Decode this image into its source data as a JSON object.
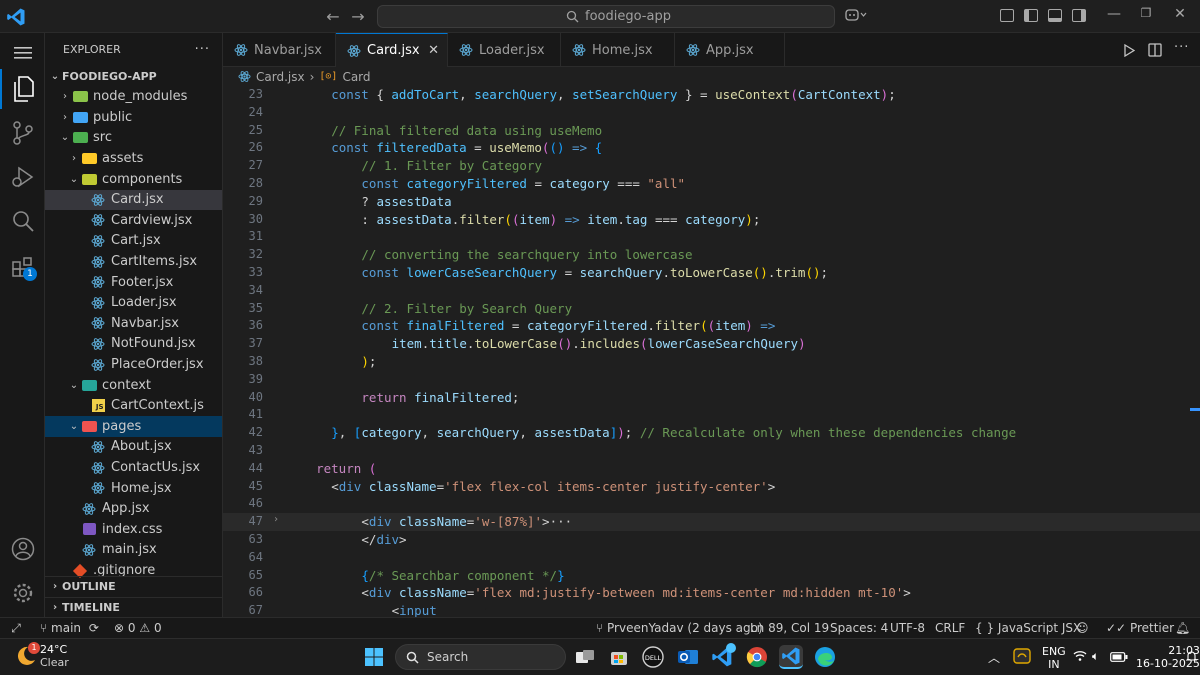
{
  "titlebar": {
    "search_text": "foodiego-app"
  },
  "sidebar": {
    "title": "EXPLORER",
    "more": "···",
    "project": "FOODIEGO-APP",
    "tree": [
      {
        "label": "node_modules",
        "depth": 1,
        "type": "folder",
        "open": false,
        "icon": "folder-node"
      },
      {
        "label": "public",
        "depth": 1,
        "type": "folder",
        "open": false,
        "icon": "folder-public"
      },
      {
        "label": "src",
        "depth": 1,
        "type": "folder",
        "open": true,
        "icon": "folder-src"
      },
      {
        "label": "assets",
        "depth": 2,
        "type": "folder",
        "open": false,
        "icon": "folder-assets"
      },
      {
        "label": "components",
        "depth": 2,
        "type": "folder",
        "open": true,
        "icon": "folder-components"
      },
      {
        "label": "Card.jsx",
        "depth": 3,
        "type": "react",
        "selected": true
      },
      {
        "label": "Cardview.jsx",
        "depth": 3,
        "type": "react"
      },
      {
        "label": "Cart.jsx",
        "depth": 3,
        "type": "react"
      },
      {
        "label": "CartItems.jsx",
        "depth": 3,
        "type": "react"
      },
      {
        "label": "Footer.jsx",
        "depth": 3,
        "type": "react"
      },
      {
        "label": "Loader.jsx",
        "depth": 3,
        "type": "react"
      },
      {
        "label": "Navbar.jsx",
        "depth": 3,
        "type": "react"
      },
      {
        "label": "NotFound.jsx",
        "depth": 3,
        "type": "react"
      },
      {
        "label": "PlaceOrder.jsx",
        "depth": 3,
        "type": "react"
      },
      {
        "label": "context",
        "depth": 2,
        "type": "folder",
        "open": true,
        "icon": "folder-context"
      },
      {
        "label": "CartContext.js",
        "depth": 3,
        "type": "js"
      },
      {
        "label": "pages",
        "depth": 2,
        "type": "folder",
        "open": true,
        "icon": "folder-pages",
        "focused": true
      },
      {
        "label": "About.jsx",
        "depth": 3,
        "type": "react"
      },
      {
        "label": "ContactUs.jsx",
        "depth": 3,
        "type": "react"
      },
      {
        "label": "Home.jsx",
        "depth": 3,
        "type": "react"
      },
      {
        "label": "App.jsx",
        "depth": 2,
        "type": "react"
      },
      {
        "label": "index.css",
        "depth": 2,
        "type": "css"
      },
      {
        "label": "main.jsx",
        "depth": 2,
        "type": "react"
      },
      {
        "label": ".gitignore",
        "depth": 1,
        "type": "git"
      }
    ],
    "outline": "OUTLINE",
    "timeline": "TIMELINE"
  },
  "tabs": [
    {
      "label": "Navbar.jsx",
      "active": false
    },
    {
      "label": "Card.jsx",
      "active": true
    },
    {
      "label": "Loader.jsx",
      "active": false
    },
    {
      "label": "Home.jsx",
      "active": false
    },
    {
      "label": "App.jsx",
      "active": false
    }
  ],
  "breadcrumb": {
    "file": "Card.jsx",
    "symbol": "Card"
  },
  "editor": {
    "lines": [
      {
        "n": "23",
        "indent": 1,
        "t": [
          [
            "dk",
            "const "
          ],
          [
            "pn",
            "{ "
          ],
          [
            "cn",
            "addToCart"
          ],
          [
            "pn",
            ", "
          ],
          [
            "cn",
            "searchQuery"
          ],
          [
            "pn",
            ", "
          ],
          [
            "cn",
            "setSearchQuery"
          ],
          [
            "pn",
            " } = "
          ],
          [
            "fn",
            "useContext"
          ],
          [
            "b2",
            "("
          ],
          [
            "vr",
            "CartContext"
          ],
          [
            "b2",
            ")"
          ],
          [
            "pn",
            ";"
          ]
        ]
      },
      {
        "n": "24",
        "indent": 0,
        "t": []
      },
      {
        "n": "25",
        "indent": 1,
        "t": [
          [
            "cm",
            "// Final filtered data using useMemo"
          ]
        ]
      },
      {
        "n": "26",
        "indent": 1,
        "t": [
          [
            "dk",
            "const "
          ],
          [
            "cn",
            "filteredData"
          ],
          [
            "pn",
            " = "
          ],
          [
            "fn",
            "useMemo"
          ],
          [
            "b2",
            "("
          ],
          [
            "b3",
            "("
          ],
          [
            "b3",
            ")"
          ],
          [
            "dk",
            " =>"
          ],
          [
            "pn",
            " "
          ],
          [
            "b3",
            "{"
          ]
        ]
      },
      {
        "n": "27",
        "indent": 2,
        "t": [
          [
            "cm",
            "// 1. Filter by Category"
          ]
        ]
      },
      {
        "n": "28",
        "indent": 2,
        "t": [
          [
            "dk",
            "const "
          ],
          [
            "cn",
            "categoryFiltered"
          ],
          [
            "pn",
            " = "
          ],
          [
            "vr",
            "category"
          ],
          [
            "pn",
            " === "
          ],
          [
            "st",
            "\"all\""
          ]
        ]
      },
      {
        "n": "29",
        "indent": 2,
        "t": [
          [
            "pn",
            "? "
          ],
          [
            "vr",
            "assestData"
          ]
        ]
      },
      {
        "n": "30",
        "indent": 2,
        "t": [
          [
            "pn",
            ": "
          ],
          [
            "vr",
            "assestData"
          ],
          [
            "pn",
            "."
          ],
          [
            "fn",
            "filter"
          ],
          [
            "b1",
            "("
          ],
          [
            "b2",
            "("
          ],
          [
            "vr",
            "item"
          ],
          [
            "b2",
            ")"
          ],
          [
            "dk",
            " =>"
          ],
          [
            "pn",
            " "
          ],
          [
            "vr",
            "item"
          ],
          [
            "pn",
            "."
          ],
          [
            "vr",
            "tag"
          ],
          [
            "pn",
            " === "
          ],
          [
            "vr",
            "category"
          ],
          [
            "b1",
            ")"
          ],
          [
            "pn",
            ";"
          ]
        ]
      },
      {
        "n": "31",
        "indent": 0,
        "t": []
      },
      {
        "n": "32",
        "indent": 2,
        "t": [
          [
            "cm",
            "// converting the searchquery into lowercase"
          ]
        ]
      },
      {
        "n": "33",
        "indent": 2,
        "t": [
          [
            "dk",
            "const "
          ],
          [
            "cn",
            "lowerCaseSearchQuery"
          ],
          [
            "pn",
            " = "
          ],
          [
            "vr",
            "searchQuery"
          ],
          [
            "pn",
            "."
          ],
          [
            "fn",
            "toLowerCase"
          ],
          [
            "b1",
            "()"
          ],
          [
            "pn",
            "."
          ],
          [
            "fn",
            "trim"
          ],
          [
            "b1",
            "()"
          ],
          [
            "pn",
            ";"
          ]
        ]
      },
      {
        "n": "34",
        "indent": 0,
        "t": []
      },
      {
        "n": "35",
        "indent": 2,
        "t": [
          [
            "cm",
            "// 2. Filter by Search Query"
          ]
        ]
      },
      {
        "n": "36",
        "indent": 2,
        "t": [
          [
            "dk",
            "const "
          ],
          [
            "cn",
            "finalFiltered"
          ],
          [
            "pn",
            " = "
          ],
          [
            "vr",
            "categoryFiltered"
          ],
          [
            "pn",
            "."
          ],
          [
            "fn",
            "filter"
          ],
          [
            "b1",
            "("
          ],
          [
            "b2",
            "("
          ],
          [
            "vr",
            "item"
          ],
          [
            "b2",
            ")"
          ],
          [
            "dk",
            " =>"
          ]
        ]
      },
      {
        "n": "37",
        "indent": 3,
        "t": [
          [
            "vr",
            "item"
          ],
          [
            "pn",
            "."
          ],
          [
            "vr",
            "title"
          ],
          [
            "pn",
            "."
          ],
          [
            "fn",
            "toLowerCase"
          ],
          [
            "b2",
            "()"
          ],
          [
            "pn",
            "."
          ],
          [
            "fn",
            "includes"
          ],
          [
            "b2",
            "("
          ],
          [
            "vr",
            "lowerCaseSearchQuery"
          ],
          [
            "b2",
            ")"
          ]
        ]
      },
      {
        "n": "38",
        "indent": 2,
        "t": [
          [
            "b1",
            ")"
          ],
          [
            "pn",
            ";"
          ]
        ]
      },
      {
        "n": "39",
        "indent": 0,
        "t": []
      },
      {
        "n": "40",
        "indent": 2,
        "t": [
          [
            "kw",
            "return "
          ],
          [
            "vr",
            "finalFiltered"
          ],
          [
            "pn",
            ";"
          ]
        ]
      },
      {
        "n": "41",
        "indent": 0,
        "t": []
      },
      {
        "n": "42",
        "indent": 1,
        "t": [
          [
            "b3",
            "}"
          ],
          [
            "pn",
            ", "
          ],
          [
            "b3",
            "["
          ],
          [
            "vr",
            "category"
          ],
          [
            "pn",
            ", "
          ],
          [
            "vr",
            "searchQuery"
          ],
          [
            "pn",
            ", "
          ],
          [
            "vr",
            "assestData"
          ],
          [
            "b3",
            "]"
          ],
          [
            "b2",
            ")"
          ],
          [
            "pn",
            "; "
          ],
          [
            "cm",
            "// Recalculate only when these dependencies change"
          ]
        ]
      },
      {
        "n": "43",
        "indent": 0,
        "t": []
      },
      {
        "n": "44",
        "indent": 0.5,
        "t": [
          [
            "kw",
            "return "
          ],
          [
            "b2",
            "("
          ]
        ]
      },
      {
        "n": "45",
        "indent": 1,
        "t": [
          [
            "pn",
            "<"
          ],
          [
            "tg",
            "div "
          ],
          [
            "at",
            "className"
          ],
          [
            "pn",
            "="
          ],
          [
            "st",
            "'flex flex-col items-center justify-center'"
          ],
          [
            "pn",
            ">"
          ]
        ]
      },
      {
        "n": "46",
        "indent": 0,
        "t": []
      },
      {
        "n": "47",
        "indent": 2,
        "fold": true,
        "current": true,
        "t": [
          [
            "pn",
            "<"
          ],
          [
            "tg",
            "div "
          ],
          [
            "at",
            "className"
          ],
          [
            "pn",
            "="
          ],
          [
            "st",
            "'w-[87%]'"
          ],
          [
            "pn",
            ">"
          ],
          [
            "pn",
            "···"
          ]
        ]
      },
      {
        "n": "63",
        "indent": 2,
        "t": [
          [
            "pn",
            "</"
          ],
          [
            "tg",
            "div"
          ],
          [
            "pn",
            ">"
          ]
        ]
      },
      {
        "n": "64",
        "indent": 0,
        "t": []
      },
      {
        "n": "65",
        "indent": 2,
        "t": [
          [
            "b3",
            "{"
          ],
          [
            "cm",
            "/* Searchbar component */"
          ],
          [
            "b3",
            "}"
          ]
        ]
      },
      {
        "n": "66",
        "indent": 2,
        "t": [
          [
            "pn",
            "<"
          ],
          [
            "tg",
            "div "
          ],
          [
            "at",
            "className"
          ],
          [
            "pn",
            "="
          ],
          [
            "st",
            "'flex md:justify-between md:items-center md:hidden mt-10'"
          ],
          [
            "pn",
            ">"
          ]
        ]
      },
      {
        "n": "67",
        "indent": 3,
        "t": [
          [
            "pn",
            "<"
          ],
          [
            "tg",
            "input"
          ]
        ]
      }
    ]
  },
  "statusbar": {
    "branch": "main",
    "errors": "0",
    "warnings": "0",
    "blame": "PrveenYadav (2 days ago)",
    "position": "Ln 89, Col 19",
    "spaces": "Spaces: 4",
    "encoding": "UTF-8",
    "eol": "CRLF",
    "language": "JavaScript JSX",
    "prettier": "Prettier"
  },
  "taskbar": {
    "temp": "24°C",
    "weather": "Clear",
    "weather_badge": "1",
    "search": "Search",
    "lang1": "ENG",
    "lang2": "IN",
    "time": "21:03",
    "date": "16-10-2025"
  },
  "activity": {
    "extensions_badge": "1"
  }
}
